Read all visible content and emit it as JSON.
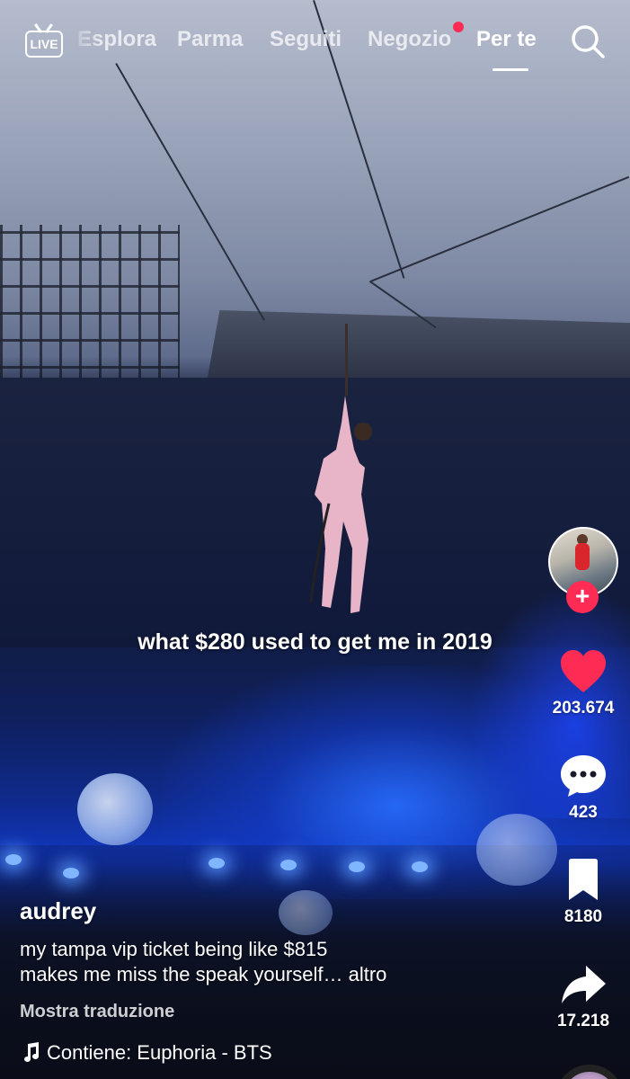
{
  "top_nav": {
    "live_label": "LIVE",
    "tabs": [
      {
        "label": "Esplora"
      },
      {
        "label": "Parma"
      },
      {
        "label": "Seguiti"
      },
      {
        "label": "Negozio"
      },
      {
        "label": "Per te"
      }
    ],
    "active_tab": "Per te"
  },
  "video": {
    "caption": "what $280 used to get me in 2019"
  },
  "actions": {
    "likes": "203.674",
    "comments": "423",
    "saves": "8180",
    "shares": "17.218"
  },
  "post": {
    "username": "audrey",
    "description_line1": "my tampa vip ticket being like $815",
    "description_line2": "makes me miss the speak yourself…",
    "more_label": "altro",
    "translate_label": "Mostra traduzione",
    "music": "Contiene: Euphoria - BTS"
  },
  "colors": {
    "accent": "#fe2c55",
    "text": "#ffffff"
  },
  "icons": [
    "live-icon",
    "search-icon",
    "heart-icon",
    "comment-icon",
    "bookmark-icon",
    "share-icon",
    "music-note-icon",
    "plus-icon"
  ]
}
